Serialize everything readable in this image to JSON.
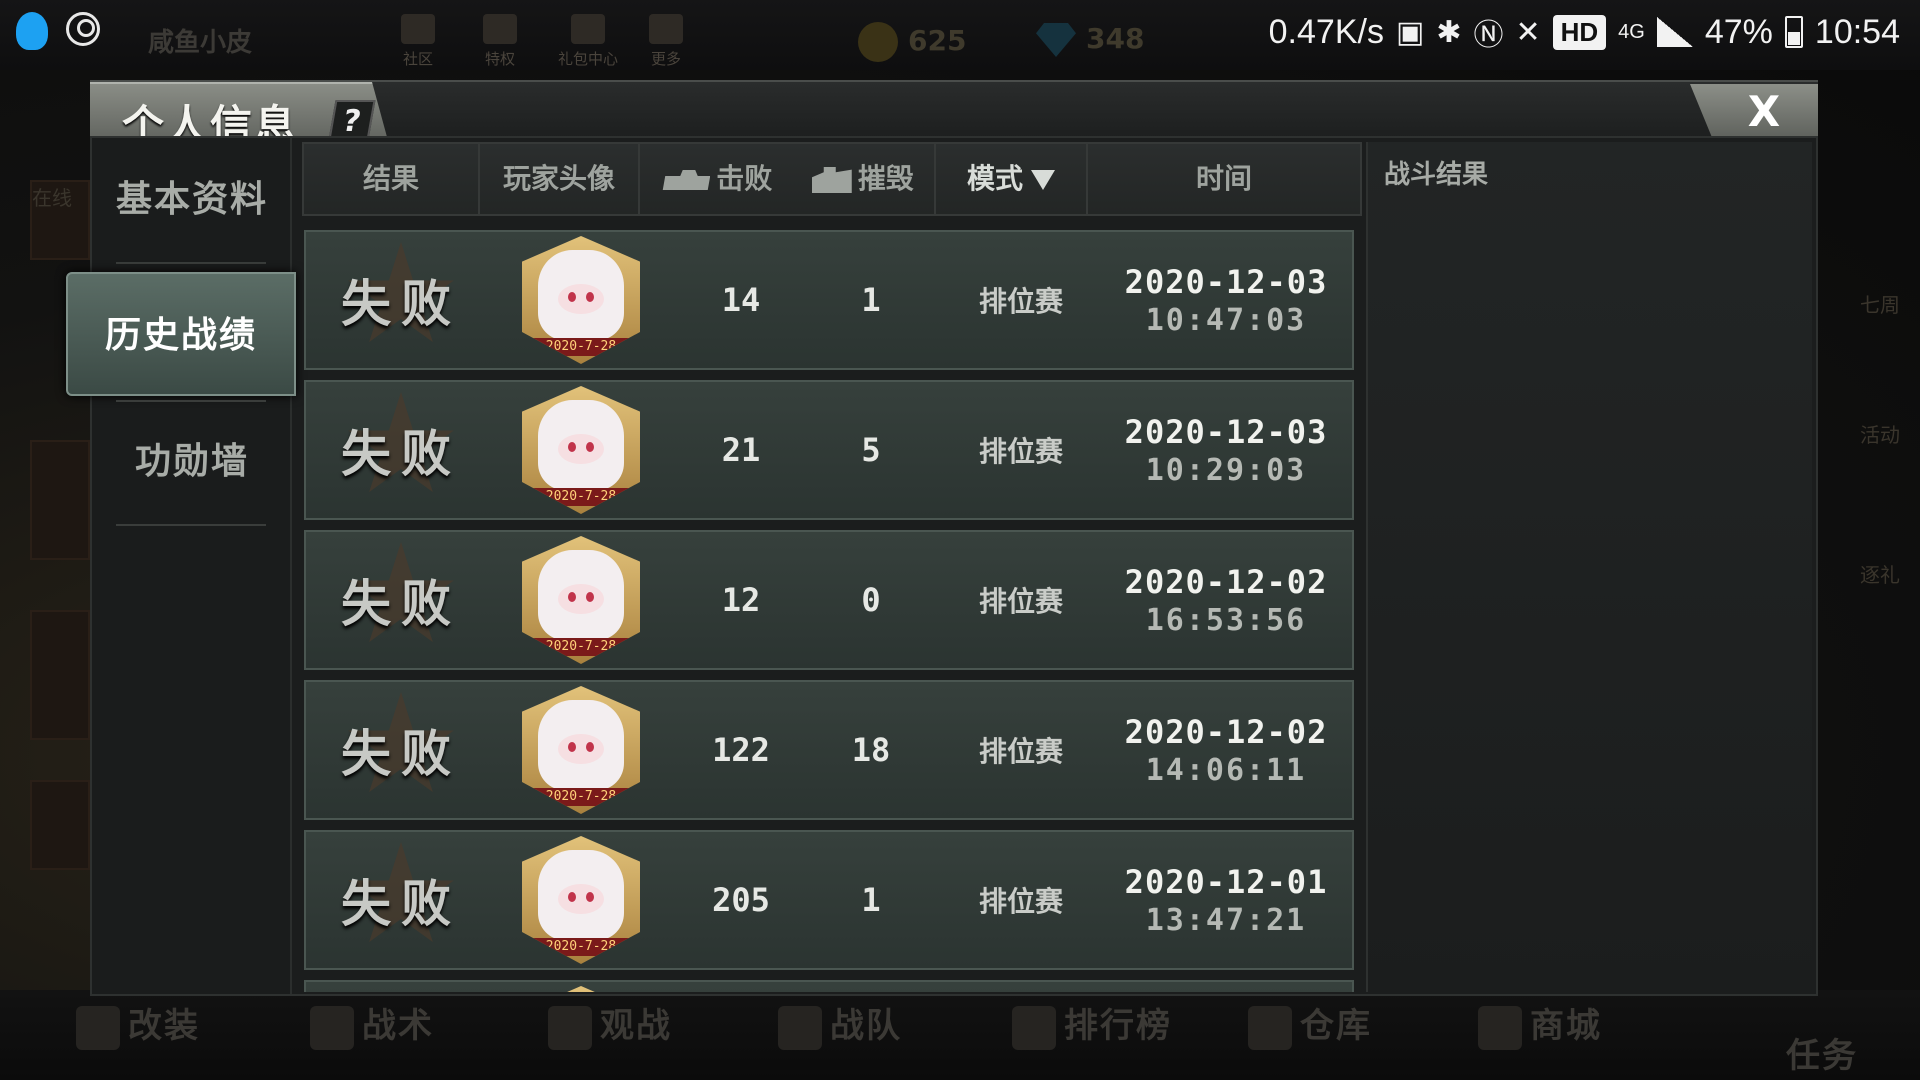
{
  "status_bar": {
    "net_speed": "0.47K/s",
    "hd": "HD",
    "network": "4G",
    "battery": "47%",
    "time": "10:54"
  },
  "background": {
    "player_name": "咸鱼小皮",
    "top_nav": [
      "社区",
      "特权",
      "礼包中心",
      "更多"
    ],
    "gold": "625",
    "diamond": "348",
    "bottom_nav": [
      "改装",
      "战术",
      "观战",
      "战队",
      "排行榜",
      "仓库",
      "商城"
    ],
    "task": "任务",
    "online": "在线",
    "right_labels": [
      "七周",
      "活动",
      "逐礼"
    ]
  },
  "dialog": {
    "title": "个人信息",
    "help": "?",
    "close": "X",
    "menu": [
      {
        "label": "基本资料",
        "active": false
      },
      {
        "label": "历史战绩",
        "active": true
      },
      {
        "label": "功勋墙",
        "active": false
      }
    ],
    "columns": {
      "result": "结果",
      "avatar": "玩家头像",
      "kills": "击败",
      "destroy": "摧毁",
      "mode": "模式",
      "time": "时间"
    },
    "battle_result_title": "战斗结果",
    "rows": [
      {
        "result": "失败",
        "avatar_date": "2020-7-28",
        "kills": "14",
        "destroy": "1",
        "mode": "排位赛",
        "date": "2020-12-03",
        "time": "10:47:03"
      },
      {
        "result": "失败",
        "avatar_date": "2020-7-28",
        "kills": "21",
        "destroy": "5",
        "mode": "排位赛",
        "date": "2020-12-03",
        "time": "10:29:03"
      },
      {
        "result": "失败",
        "avatar_date": "2020-7-28",
        "kills": "12",
        "destroy": "0",
        "mode": "排位赛",
        "date": "2020-12-02",
        "time": "16:53:56"
      },
      {
        "result": "失败",
        "avatar_date": "2020-7-28",
        "kills": "122",
        "destroy": "18",
        "mode": "排位赛",
        "date": "2020-12-02",
        "time": "14:06:11"
      },
      {
        "result": "失败",
        "avatar_date": "2020-7-28",
        "kills": "205",
        "destroy": "1",
        "mode": "排位赛",
        "date": "2020-12-01",
        "time": "13:47:21"
      }
    ]
  }
}
